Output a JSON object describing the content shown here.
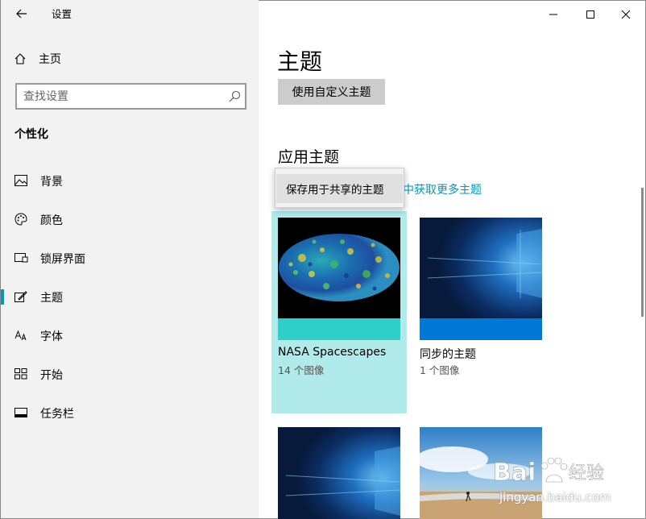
{
  "window": {
    "title": "设置"
  },
  "sidebar": {
    "home_label": "主页",
    "search_placeholder": "查找设置",
    "section_title": "个性化",
    "items": [
      {
        "label": "背景",
        "icon": "image-icon",
        "selected": false
      },
      {
        "label": "颜色",
        "icon": "palette-icon",
        "selected": false
      },
      {
        "label": "锁屏界面",
        "icon": "lock-screen-icon",
        "selected": false
      },
      {
        "label": "主题",
        "icon": "theme-brush-icon",
        "selected": true
      },
      {
        "label": "字体",
        "icon": "font-icon",
        "selected": false
      },
      {
        "label": "开始",
        "icon": "start-icon",
        "selected": false
      },
      {
        "label": "任务栏",
        "icon": "taskbar-icon",
        "selected": false
      }
    ]
  },
  "main": {
    "page_title": "主题",
    "custom_theme_button": "使用自定义主题",
    "apply_title": "应用主题",
    "more_themes_link": "中获取更多主题",
    "context_menu_item": "保存用于共享的主题",
    "themes": [
      {
        "name": "NASA Spacescapes",
        "count": "14 个图像",
        "selected": true,
        "accent": "#2ecfc8"
      },
      {
        "name": "同步的主题",
        "count": "1 个图像",
        "selected": false,
        "accent": "#0078d7"
      }
    ]
  },
  "colors": {
    "accent": "#0099bc",
    "sidebar_bg": "#f2f2f2",
    "selected_tile_bg": "#b0eaeb"
  },
  "watermark": {
    "text": "jingyan.baidu.com"
  }
}
